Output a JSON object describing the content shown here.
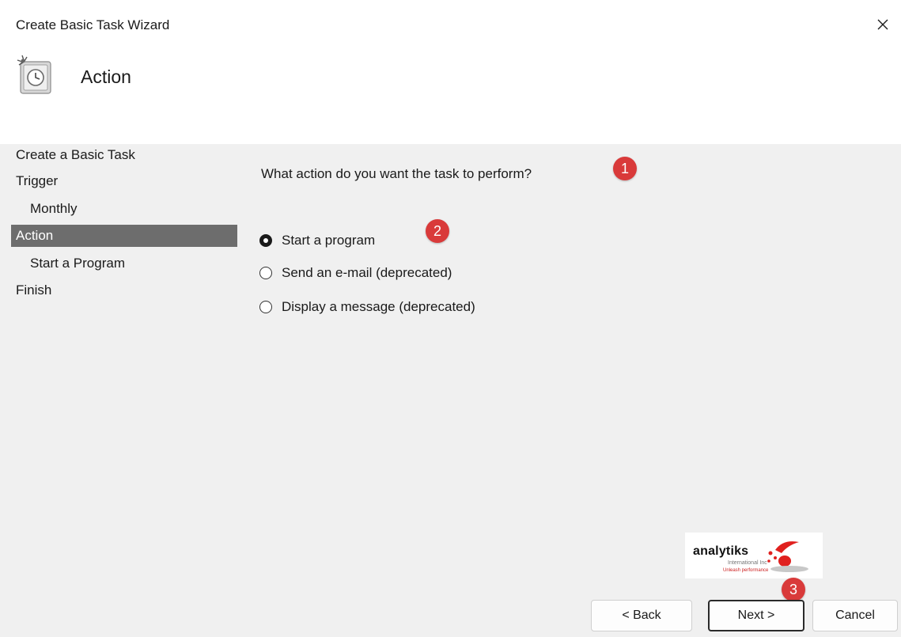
{
  "window": {
    "title": "Create Basic Task Wizard",
    "close_glyph": "✕"
  },
  "header": {
    "icon": "scheduled-task-icon",
    "title": "Action"
  },
  "steps": [
    {
      "label": "Create a Basic Task",
      "level": 0,
      "active": false
    },
    {
      "label": "Trigger",
      "level": 0,
      "active": false
    },
    {
      "label": "Monthly",
      "level": 1,
      "active": false
    },
    {
      "label": "Action",
      "level": 0,
      "active": true
    },
    {
      "label": "Start a Program",
      "level": 1,
      "active": false
    },
    {
      "label": "Finish",
      "level": 0,
      "active": false
    }
  ],
  "content": {
    "question": "What action do you want the task to perform?",
    "options": [
      {
        "label": "Start a program",
        "selected": true
      },
      {
        "label": "Send an e-mail (deprecated)",
        "selected": false
      },
      {
        "label": "Display a message (deprecated)",
        "selected": false
      }
    ]
  },
  "annotations": [
    "1",
    "2",
    "3"
  ],
  "logo": {
    "name": "analytiks",
    "subtitle": "International Inc",
    "tagline": "Unleash performance"
  },
  "buttons": {
    "back": "< Back",
    "next": "Next >",
    "cancel": "Cancel"
  },
  "colors": {
    "active_step_bg": "#6d6d6d",
    "badge": "#d93a3a",
    "panel_bg": "#f0f0f0"
  }
}
